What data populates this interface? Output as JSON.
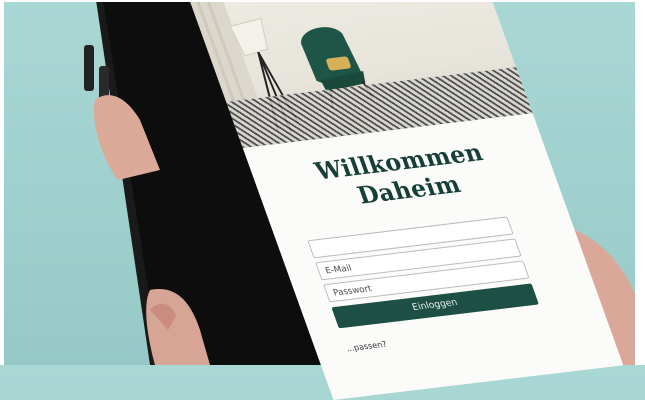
{
  "screen": {
    "title_line1": "Willkommen",
    "title_line2": "Daheim",
    "email_placeholder": "E-Mail",
    "password_placeholder": "Passwort",
    "login_label": "Einloggen",
    "forgot_label": "...passen?"
  },
  "colors": {
    "background": "#a9d7d4",
    "brand_green": "#1d4f45",
    "title_green": "#163f37",
    "chair_green": "#1f5546"
  }
}
